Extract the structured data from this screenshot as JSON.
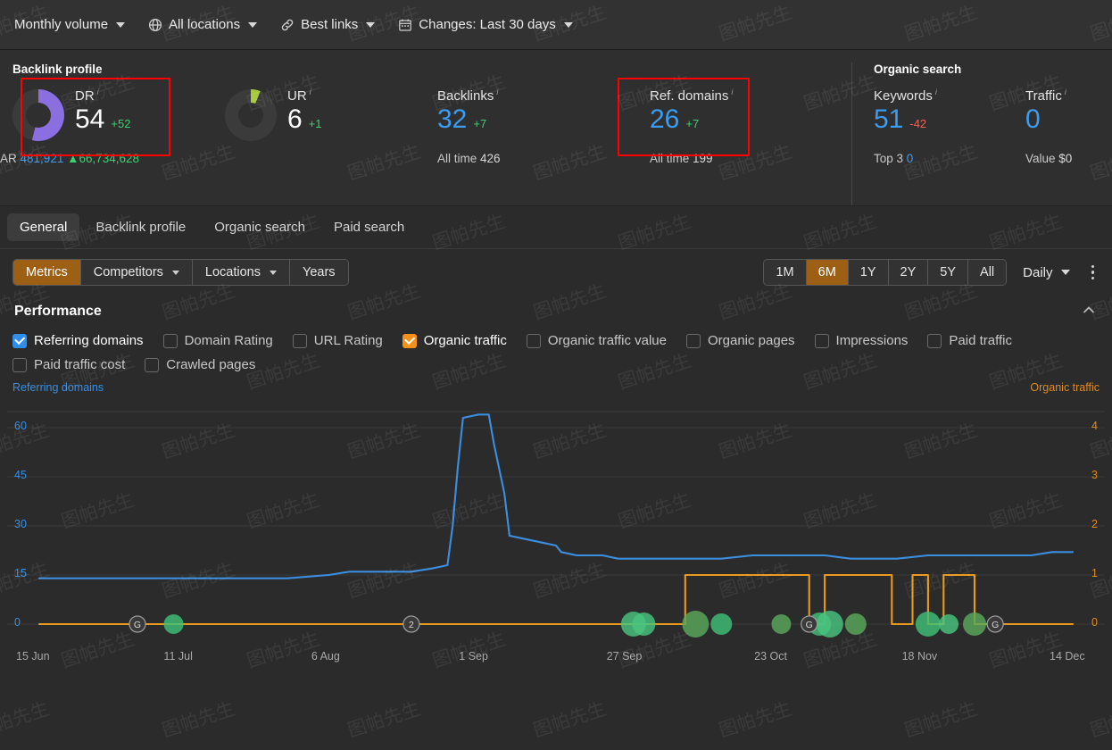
{
  "topbar": {
    "filters": [
      {
        "label": "Monthly volume",
        "icon": "none"
      },
      {
        "label": "All locations",
        "icon": "globe-icon"
      },
      {
        "label": "Best links",
        "icon": "link-icon"
      },
      {
        "label": "Changes: Last 30 days",
        "icon": "calendar-icon"
      }
    ]
  },
  "metrics": {
    "backlink_profile": {
      "title": "Backlink profile",
      "dr": {
        "label": "DR",
        "value": "54",
        "delta": "+52",
        "delta_dir": "up",
        "sub_label": "AR",
        "sub_value": "481,921",
        "sub_delta": "66,734,628",
        "donut_pct": 54,
        "donut_color": "#8b6ee0"
      },
      "ur": {
        "label": "UR",
        "value": "6",
        "delta": "+1",
        "delta_dir": "up",
        "donut_pct": 6,
        "donut_color": "#a6c93a"
      },
      "backlinks": {
        "label": "Backlinks",
        "value": "32",
        "delta": "+7",
        "delta_dir": "up",
        "sub_label": "All time",
        "sub_value": "426"
      },
      "ref_domains": {
        "label": "Ref. domains",
        "value": "26",
        "delta": "+7",
        "delta_dir": "up",
        "sub_label": "All time",
        "sub_value": "199"
      }
    },
    "organic_search": {
      "title": "Organic search",
      "keywords": {
        "label": "Keywords",
        "value": "51",
        "delta": "-42",
        "delta_dir": "down",
        "sub_label": "Top 3",
        "sub_value": "0"
      },
      "traffic": {
        "label": "Traffic",
        "value": "0",
        "sub_label": "Value",
        "sub_value": "$0"
      }
    },
    "highlight_color": "#ff0000"
  },
  "section_tabs": {
    "items": [
      {
        "label": "General",
        "active": true
      },
      {
        "label": "Backlink profile",
        "active": false
      },
      {
        "label": "Organic search",
        "active": false
      },
      {
        "label": "Paid search",
        "active": false
      }
    ]
  },
  "controls": {
    "left": [
      {
        "label": "Metrics",
        "active": true,
        "dropdown": false
      },
      {
        "label": "Competitors",
        "active": false,
        "dropdown": true
      },
      {
        "label": "Locations",
        "active": false,
        "dropdown": true
      },
      {
        "label": "Years",
        "active": false,
        "dropdown": false
      }
    ],
    "ranges": [
      {
        "label": "1M",
        "active": false
      },
      {
        "label": "6M",
        "active": true
      },
      {
        "label": "1Y",
        "active": false
      },
      {
        "label": "2Y",
        "active": false
      },
      {
        "label": "5Y",
        "active": false
      },
      {
        "label": "All",
        "active": false
      }
    ],
    "granularity": "Daily",
    "accent_color": "#9c5f14"
  },
  "performance": {
    "title": "Performance",
    "collapse_icon": "chevron-up-icon",
    "metrics": [
      {
        "label": "Referring domains",
        "checked": true,
        "color": "blue"
      },
      {
        "label": "Domain Rating",
        "checked": false,
        "color": ""
      },
      {
        "label": "URL Rating",
        "checked": false,
        "color": ""
      },
      {
        "label": "Organic traffic",
        "checked": true,
        "color": "orange"
      },
      {
        "label": "Organic traffic value",
        "checked": false,
        "color": ""
      },
      {
        "label": "Organic pages",
        "checked": false,
        "color": ""
      },
      {
        "label": "Impressions",
        "checked": false,
        "color": ""
      },
      {
        "label": "Paid traffic",
        "checked": false,
        "color": ""
      },
      {
        "label": "Paid traffic cost",
        "checked": false,
        "color": ""
      },
      {
        "label": "Crawled pages",
        "checked": false,
        "color": ""
      }
    ]
  },
  "chart_data": {
    "type": "line",
    "title": "Performance",
    "left_axis_label": "Referring domains",
    "right_axis_label": "Organic traffic",
    "left_color": "#3b8ee0",
    "right_color": "#e08b1e",
    "left_ticks": [
      "60",
      "45",
      "30",
      "15",
      "0"
    ],
    "right_ticks": [
      "4",
      "3",
      "2",
      "1",
      "0"
    ],
    "ylim_left": [
      0,
      67.5
    ],
    "ylim_right": [
      0,
      4.5
    ],
    "x_ticks": [
      "15 Jun",
      "11 Jul",
      "6 Aug",
      "1 Sep",
      "27 Sep",
      "23 Oct",
      "18 Nov",
      "14 Dec"
    ],
    "grid": true,
    "series": [
      {
        "name": "Referring domains",
        "axis": "left",
        "color": "#3b8ee0",
        "points": [
          [
            0.0,
            14
          ],
          [
            0.04,
            14
          ],
          [
            0.08,
            14
          ],
          [
            0.12,
            14
          ],
          [
            0.16,
            14
          ],
          [
            0.2,
            14
          ],
          [
            0.24,
            14
          ],
          [
            0.28,
            15
          ],
          [
            0.3,
            16
          ],
          [
            0.32,
            16
          ],
          [
            0.34,
            16
          ],
          [
            0.36,
            16
          ],
          [
            0.38,
            17
          ],
          [
            0.395,
            18
          ],
          [
            0.4,
            30
          ],
          [
            0.405,
            48
          ],
          [
            0.41,
            63
          ],
          [
            0.425,
            64
          ],
          [
            0.435,
            64
          ],
          [
            0.44,
            55
          ],
          [
            0.45,
            40
          ],
          [
            0.455,
            27
          ],
          [
            0.47,
            26
          ],
          [
            0.485,
            25
          ],
          [
            0.5,
            24
          ],
          [
            0.505,
            22
          ],
          [
            0.52,
            21
          ],
          [
            0.545,
            21
          ],
          [
            0.56,
            20
          ],
          [
            0.575,
            20
          ],
          [
            0.6,
            20
          ],
          [
            0.63,
            20
          ],
          [
            0.66,
            20
          ],
          [
            0.69,
            21
          ],
          [
            0.7,
            21
          ],
          [
            0.73,
            21
          ],
          [
            0.76,
            21
          ],
          [
            0.785,
            20
          ],
          [
            0.8,
            20
          ],
          [
            0.83,
            20
          ],
          [
            0.86,
            21
          ],
          [
            0.875,
            21
          ],
          [
            0.9,
            21
          ],
          [
            0.92,
            21
          ],
          [
            0.94,
            21
          ],
          [
            0.96,
            21
          ],
          [
            0.98,
            22
          ],
          [
            1.0,
            22
          ]
        ]
      },
      {
        "name": "Organic traffic",
        "axis": "right",
        "color": "#e89a1e",
        "points": [
          [
            0.0,
            0
          ],
          [
            0.2,
            0
          ],
          [
            0.4,
            0
          ],
          [
            0.55,
            0
          ],
          [
            0.6,
            0
          ],
          [
            0.62,
            0
          ],
          [
            0.625,
            1
          ],
          [
            0.7,
            1
          ],
          [
            0.74,
            1
          ],
          [
            0.745,
            0
          ],
          [
            0.755,
            0
          ],
          [
            0.76,
            1
          ],
          [
            0.8,
            1
          ],
          [
            0.82,
            1
          ],
          [
            0.825,
            0
          ],
          [
            0.84,
            0
          ],
          [
            0.845,
            1
          ],
          [
            0.855,
            1
          ],
          [
            0.86,
            0
          ],
          [
            0.87,
            0
          ],
          [
            0.875,
            1
          ],
          [
            0.9,
            1
          ],
          [
            0.905,
            0
          ],
          [
            0.95,
            0
          ],
          [
            1.0,
            0
          ]
        ]
      }
    ],
    "event_markers": [
      {
        "type": "google-update",
        "label": "G",
        "x": 0.095
      },
      {
        "type": "event-group",
        "label": "2",
        "x": 0.36
      },
      {
        "type": "google-update",
        "label": "G",
        "x": 0.745
      },
      {
        "type": "google-update",
        "label": "G",
        "x": 0.925
      }
    ],
    "event_dots": [
      0.13,
      0.585,
      0.635,
      0.66,
      0.575,
      0.718,
      0.755,
      0.765,
      0.79,
      0.86,
      0.88,
      0.905
    ]
  },
  "watermark": "图帕先生"
}
